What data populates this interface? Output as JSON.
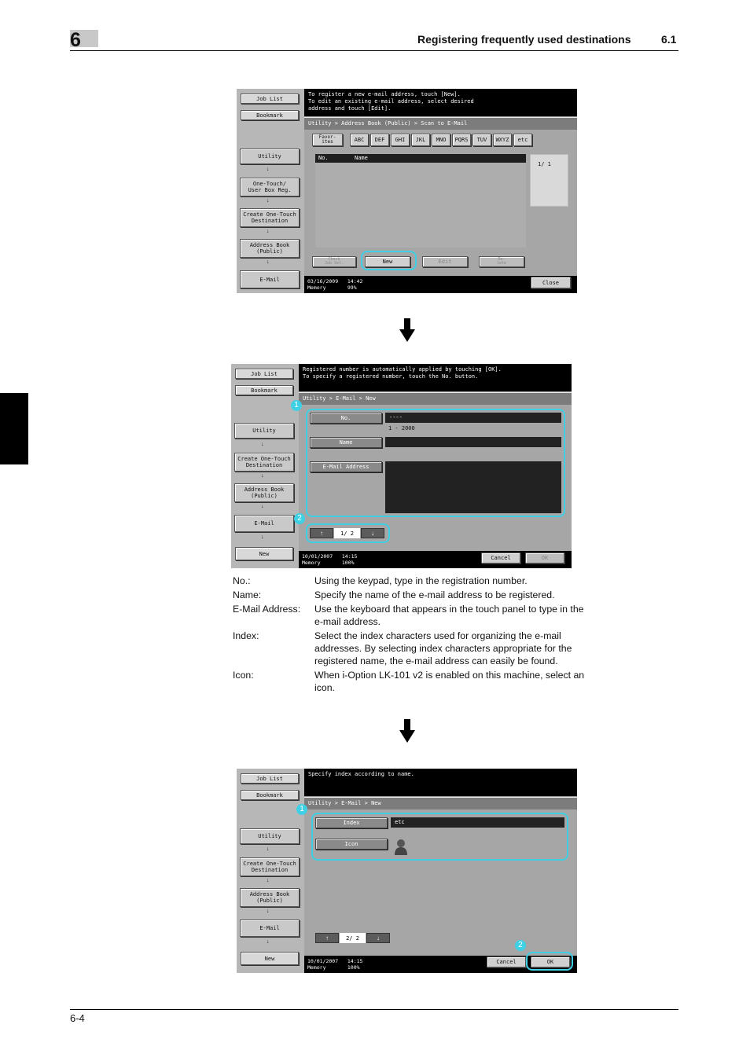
{
  "header": {
    "chapter": "6",
    "title": "Registering frequently used destinations",
    "section": "6.1"
  },
  "footer": {
    "page": "6-4"
  },
  "screen1": {
    "message": "To register a new e-mail address, touch [New].\nTo edit an existing e-mail address, select desired\naddress and touch [Edit].",
    "left": {
      "job_list": "Job List",
      "bookmark": "Bookmark",
      "utility": "Utility",
      "one_touch": "One-Touch/\nUser Box Reg.",
      "create": "Create One-Touch\nDestination",
      "address_book": "Address Book\n(Public)",
      "email": "E-Mail"
    },
    "breadcrumb": "Utility > Address Book (Public) > Scan to E-Mail",
    "index_tabs": [
      "Favor-\nites",
      "ABC",
      "DEF",
      "GHI",
      "JKL",
      "MNO",
      "PQRS",
      "TUV",
      "WXYZ",
      "etc"
    ],
    "col_no": "No.",
    "col_name": "Name",
    "page": "1/  1",
    "buttons": {
      "check_job": "Check\nJob Set.",
      "new": "New",
      "edit": "Edit",
      "delete": "De-\nlete",
      "close": "Close"
    },
    "status": "03/16/2009   14:42\nMemory       99%"
  },
  "screen2": {
    "message": "Registered number is automatically applied by touching [OK].\nTo specify a registered number, touch the No. button.",
    "left": {
      "job_list": "Job List",
      "bookmark": "Bookmark",
      "utility": "Utility",
      "create": "Create One-Touch\nDestination",
      "address_book": "Address Book\n(Public)",
      "email": "E-Mail",
      "new": "New"
    },
    "breadcrumb": "Utility > E-Mail > New",
    "fields": {
      "no_label": "No.",
      "no_value": "----",
      "no_range": "1 - 2000",
      "name_label": "Name",
      "email_label": "E-Mail Address"
    },
    "pager": "1/ 2",
    "buttons": {
      "cancel": "Cancel",
      "ok": "OK"
    },
    "status": "10/01/2007   14:15\nMemory       100%",
    "badges": [
      "1",
      "2"
    ]
  },
  "descriptions": [
    {
      "term": "No.:",
      "def": "Using the keypad, type in the registration number."
    },
    {
      "term": "Name:",
      "def": "Specify the name of the e-mail address to be registered."
    },
    {
      "term": "E-Mail Address:",
      "def": "Use the keyboard that appears in the touch panel to type in the e-mail address."
    },
    {
      "term": "Index:",
      "def": "Select the index characters used for organizing the e-mail addresses. By selecting index characters appropriate for the registered name, the e-mail address can easily be found."
    },
    {
      "term": "Icon:",
      "def": "When i-Option LK-101 v2 is enabled on this machine, select an icon."
    }
  ],
  "screen3": {
    "message": "Specify index according to name.",
    "left": {
      "job_list": "Job List",
      "bookmark": "Bookmark",
      "utility": "Utility",
      "create": "Create One-Touch\nDestination",
      "address_book": "Address Book\n(Public)",
      "email": "E-Mail",
      "new": "New"
    },
    "breadcrumb": "Utility > E-Mail > New",
    "fields": {
      "index_label": "Index",
      "index_value": "etc",
      "icon_label": "Icon"
    },
    "pager": "2/ 2",
    "buttons": {
      "cancel": "Cancel",
      "ok": "OK"
    },
    "status": "10/01/2007   14:15\nMemory       100%",
    "badges": [
      "1",
      "2"
    ]
  }
}
